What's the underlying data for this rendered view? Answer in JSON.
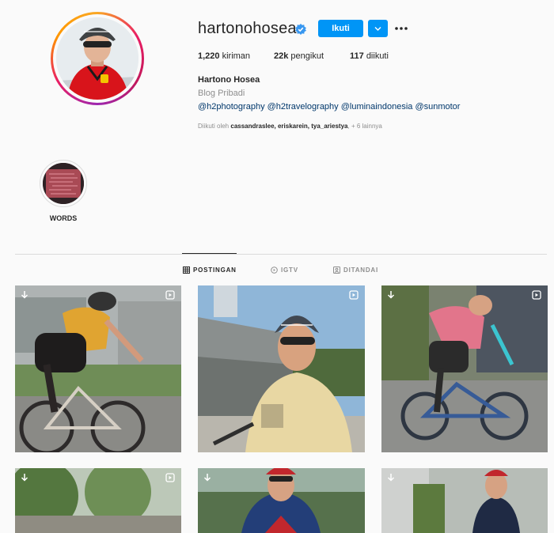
{
  "profile": {
    "username": "hartonohosea",
    "follow_label": "Ikuti",
    "stats": {
      "posts": "1,220",
      "posts_label": "kiriman",
      "followers": "22k",
      "followers_label": "pengikut",
      "following": "117",
      "following_label": "diikuti"
    },
    "full_name": "Hartono Hosea",
    "category": "Blog Pribadi",
    "bio": "@h2photography @h2travelography @luminaindonesia @sunmotor",
    "followed_by_prefix": "Diikuti oleh",
    "followed_by_names": "cassandraslee, eriskarein, tya_ariestya",
    "followed_by_more": "+ 6 lainnya"
  },
  "highlights": [
    {
      "label": "WORDS"
    }
  ],
  "tabs": [
    {
      "label": "POSTINGAN",
      "icon": "grid-icon",
      "active": true
    },
    {
      "label": "IGTV",
      "icon": "igtv-icon",
      "active": false
    },
    {
      "label": "DITANDAI",
      "icon": "tagged-icon",
      "active": false
    }
  ],
  "posts": [
    {
      "type": "video",
      "icon": "video-icon"
    },
    {
      "type": "video",
      "icon": "video-icon"
    },
    {
      "type": "video",
      "icon": "video-icon"
    },
    {
      "type": "video",
      "icon": "video-icon"
    },
    {
      "type": "video",
      "icon": "video-icon"
    },
    {
      "type": "video",
      "icon": "video-icon"
    }
  ],
  "colors": {
    "accent": "#0095f6",
    "link": "#00376b",
    "muted": "#8e8e8e",
    "text": "#262626",
    "border": "#dbdbdb"
  }
}
